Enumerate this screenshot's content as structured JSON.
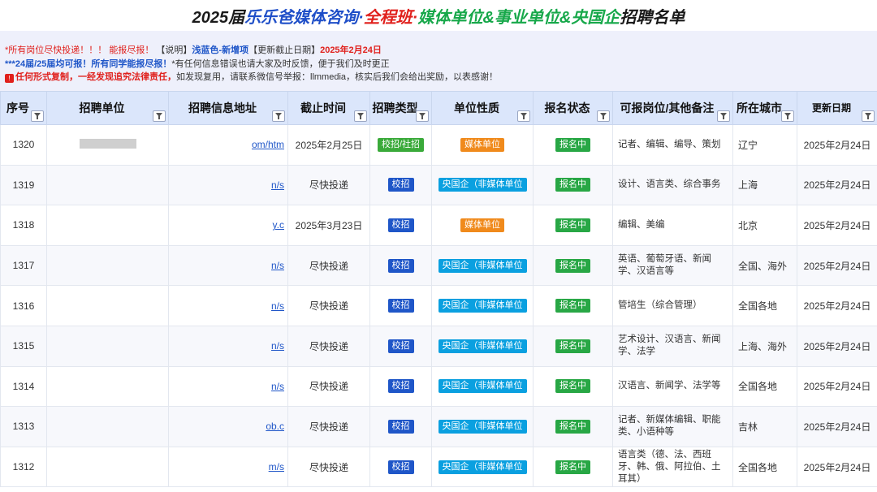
{
  "title": {
    "part1": "2025届 ",
    "part2": "乐乐爸媒体咨询·",
    "part3": "全程班·",
    "part4": "媒体单位&事业单位&央国企",
    "part5": "招聘名单"
  },
  "notes": {
    "line1_red": "*所有岗位尽快投递！！！ 能报尽报！",
    "line1_mid": "【说明】",
    "line1_blue": "浅蓝色-新增项",
    "line1_mid2": "【更新截止日期】",
    "line1_date": "2025年2月24日",
    "line2_blue": "***24届/25届均可报！所有同学能报尽报！",
    "line2_rest": "*有任何信息错误也请大家及时反馈，便于我们及时更正",
    "line3_red": "任何形式复制，一经发现追究法律责任，",
    "line3_rest": "如发现复用，请联系微信号举报：llmmedia，核实后我们会给出奖励，以表感谢！"
  },
  "headers": [
    "序号",
    "招聘单位",
    "招聘信息地址",
    "截止时间",
    "招聘类型",
    "单位性质",
    "报名状态",
    "可报岗位/其他备注",
    "所在城市",
    "更新日期"
  ],
  "colors": {
    "blue": "#1f56c8",
    "red": "#e0201c",
    "orange": "#f08a1c",
    "green": "#28a745",
    "cyan": "#0aa0e0"
  },
  "rows": [
    {
      "id": "1320",
      "url": "om/htm",
      "deadline": "2025年2月25日",
      "type": "校招/社招",
      "nature": "媒体单位",
      "status": "报名中",
      "remark": "记者、编辑、编导、策划",
      "city": "辽宁",
      "updated": "2025年2月24日"
    },
    {
      "id": "1319",
      "url": "n/s",
      "deadline": "尽快投递",
      "type": "校招",
      "nature": "央国企（非媒体单位",
      "status": "报名中",
      "remark": "设计、语言类、综合事务",
      "city": "上海",
      "updated": "2025年2月24日"
    },
    {
      "id": "1318",
      "url": "y.c",
      "deadline": "2025年3月23日",
      "type": "校招",
      "nature": "媒体单位",
      "status": "报名中",
      "remark": "编辑、美编",
      "city": "北京",
      "updated": "2025年2月24日"
    },
    {
      "id": "1317",
      "url": "n/s",
      "deadline": "尽快投递",
      "type": "校招",
      "nature": "央国企（非媒体单位",
      "status": "报名中",
      "remark": "英语、葡萄牙语、新闻学、汉语言等",
      "city": "全国、海外",
      "updated": "2025年2月24日"
    },
    {
      "id": "1316",
      "url": "n/s",
      "deadline": "尽快投递",
      "type": "校招",
      "nature": "央国企（非媒体单位",
      "status": "报名中",
      "remark": "管培生（综合管理）",
      "city": "全国各地",
      "updated": "2025年2月24日"
    },
    {
      "id": "1315",
      "url": "n/s",
      "deadline": "尽快投递",
      "type": "校招",
      "nature": "央国企（非媒体单位",
      "status": "报名中",
      "remark": "艺术设计、汉语言、新闻学、法学",
      "city": "上海、海外",
      "updated": "2025年2月24日"
    },
    {
      "id": "1314",
      "url": "n/s",
      "deadline": "尽快投递",
      "type": "校招",
      "nature": "央国企（非媒体单位",
      "status": "报名中",
      "remark": "汉语言、新闻学、法学等",
      "city": "全国各地",
      "updated": "2025年2月24日"
    },
    {
      "id": "1313",
      "url": "ob.c",
      "deadline": "尽快投递",
      "type": "校招",
      "nature": "央国企（非媒体单位",
      "status": "报名中",
      "remark": "记者、新媒体编辑、职能类、小语种等",
      "city": "吉林",
      "updated": "2025年2月24日"
    },
    {
      "id": "1312",
      "url": "m/s",
      "deadline": "尽快投递",
      "type": "校招",
      "nature": "央国企（非媒体单位",
      "status": "报名中",
      "remark": "语言类（德、法、西班牙、韩、俄、阿拉伯、土耳其）",
      "city": "全国各地",
      "updated": "2025年2月24日"
    }
  ]
}
